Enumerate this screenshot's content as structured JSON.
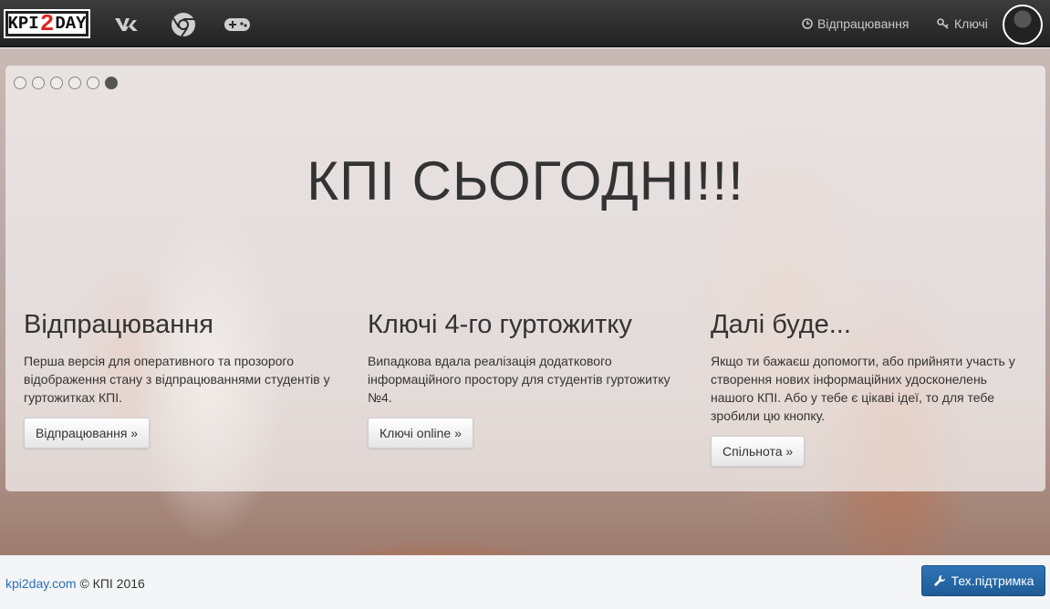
{
  "navbar": {
    "brand": {
      "part1": "KPI",
      "part2": "2",
      "part3": "DAY"
    },
    "icons": [
      "vk-icon",
      "chrome-icon",
      "gamepad-icon"
    ],
    "links": [
      {
        "label": "Відпрацювання",
        "icon": "clock-icon"
      },
      {
        "label": "Ключі",
        "icon": "key-icon"
      }
    ]
  },
  "hero": {
    "slides_count": 6,
    "active_slide": 6,
    "title": "КПІ СЬОГОДНІ!!!",
    "columns": [
      {
        "heading": "Відпрацювання",
        "text": "Перша версія для оперативного та прозорого відображення стану з відпрацюваннями студентів у гуртожитках КПІ.",
        "button": "Відпрацювання »"
      },
      {
        "heading": "Ключі 4-го гуртожитку",
        "text": "Випадкова вдала реалізація додаткового інформаційного простору для студентів гуртожитку №4.",
        "button": "Ключі online »"
      },
      {
        "heading": "Далі буде...",
        "text": "Якщо ти бажаєш допомогти, або прийняти участь у створення нових інформаційних удосконелень нашого КПІ. Або у тебе є цікаві ідеї, то для тебе зробили цю кнопку.",
        "button": "Спільнота »"
      }
    ]
  },
  "footer": {
    "link": "kpi2day.com",
    "copyright": "© КПІ 2016",
    "support_button": "Тех.підтримка"
  },
  "colors": {
    "navbar": "#2b2b2b",
    "brand_accent": "#e2231a",
    "primary": "#2a6ebb"
  }
}
